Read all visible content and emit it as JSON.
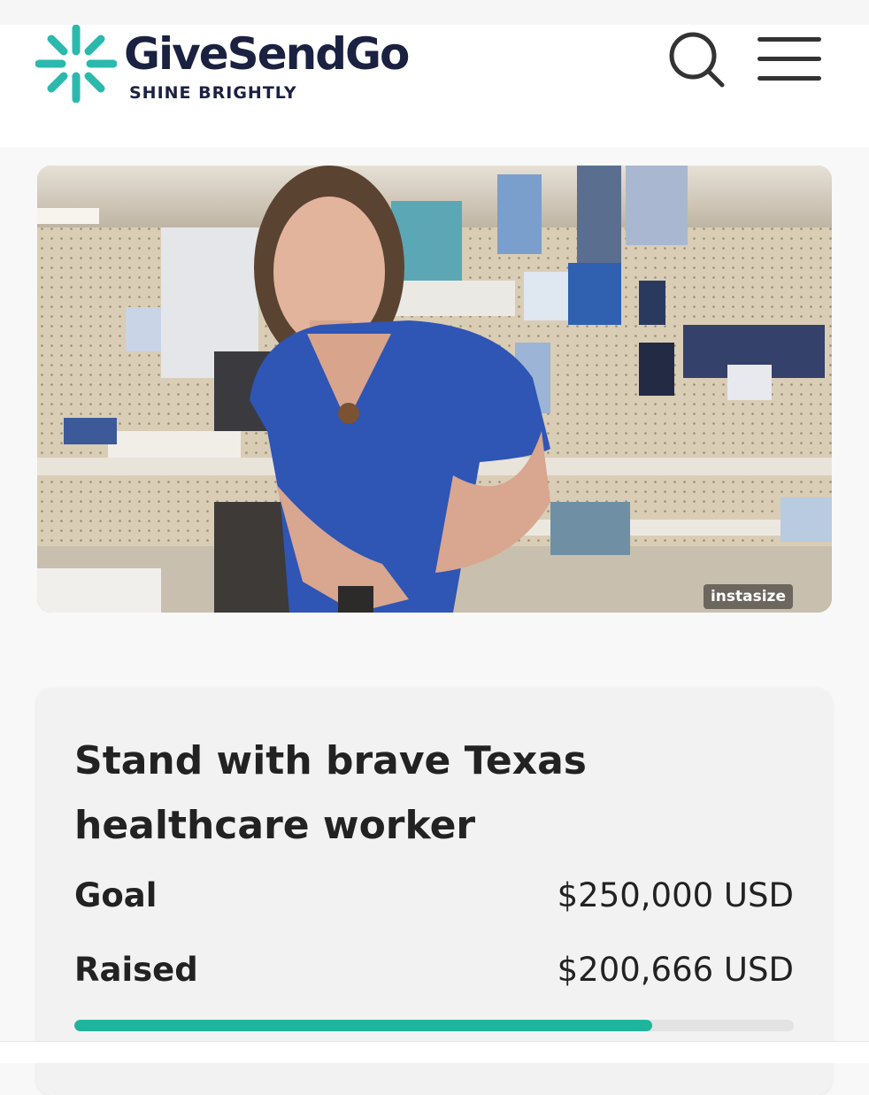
{
  "brand": {
    "name": "GiveSendGo",
    "tagline": "SHINE BRIGHTLY",
    "accent_color": "#1fb59d",
    "text_color": "#1b2140"
  },
  "header": {
    "search_icon": "search-icon",
    "menu_icon": "hamburger-menu-icon"
  },
  "hero": {
    "watermark": "instasize"
  },
  "campaign": {
    "title": "Stand with brave Texas healthcare worker",
    "goal_label": "Goal",
    "goal_value": "$250,000 USD",
    "raised_label": "Raised",
    "raised_value": "$200,666 USD",
    "progress_fraction": 0.80266,
    "progress_color": "#1fb59d"
  }
}
